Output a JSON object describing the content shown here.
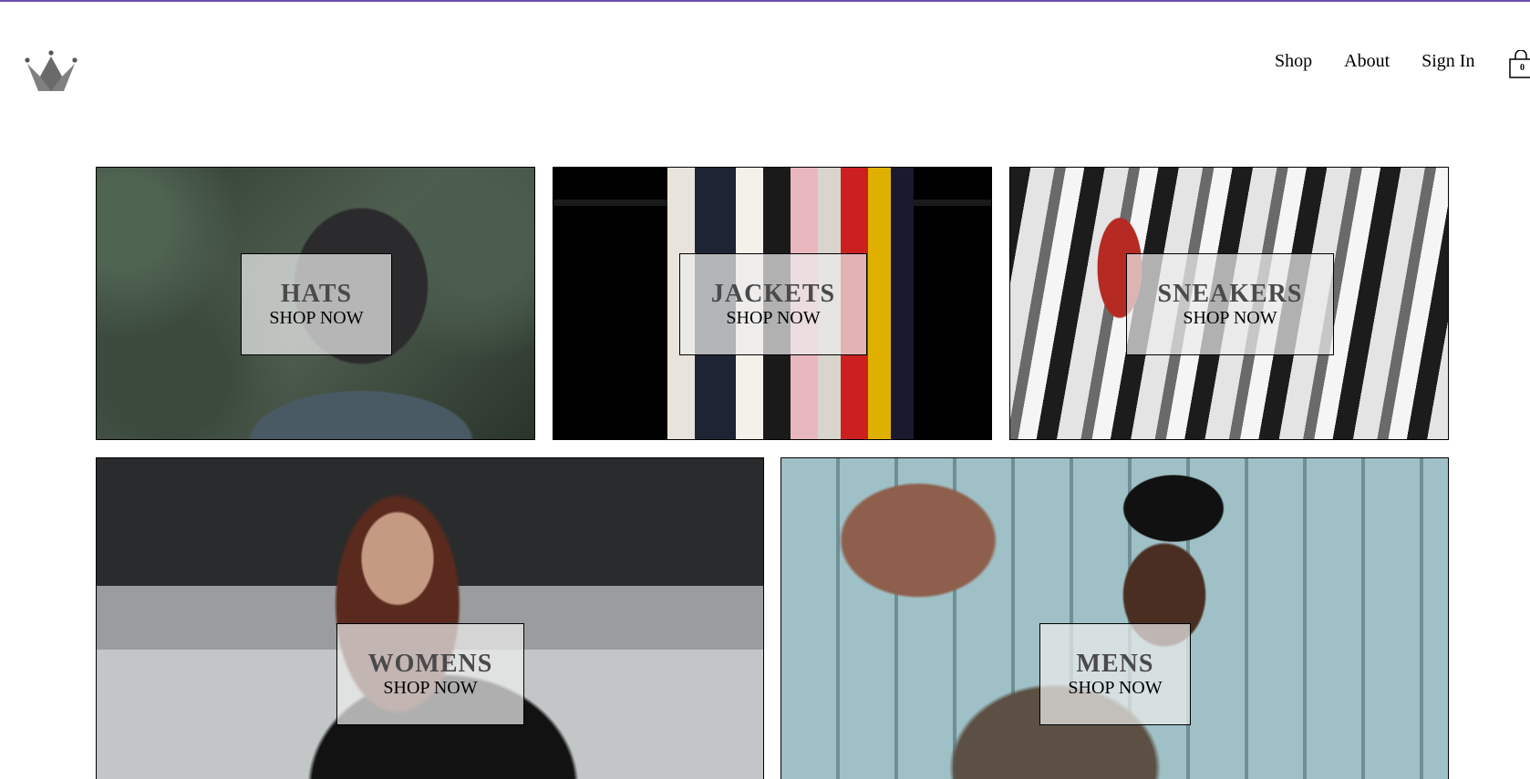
{
  "theme": {
    "accent_line": "#6f4fb3"
  },
  "header": {
    "logo_icon": "crown-icon",
    "nav": [
      {
        "label": "Shop"
      },
      {
        "label": "About"
      },
      {
        "label": "Sign In"
      }
    ],
    "cart": {
      "icon": "shopping-bag-icon",
      "count": "0"
    }
  },
  "categories": [
    {
      "title": "HATS",
      "subtitle": "SHOP NOW"
    },
    {
      "title": "JACKETS",
      "subtitle": "SHOP NOW"
    },
    {
      "title": "SNEAKERS",
      "subtitle": "SHOP NOW"
    },
    {
      "title": "WOMENS",
      "subtitle": "SHOP NOW"
    },
    {
      "title": "MENS",
      "subtitle": "SHOP NOW"
    }
  ]
}
